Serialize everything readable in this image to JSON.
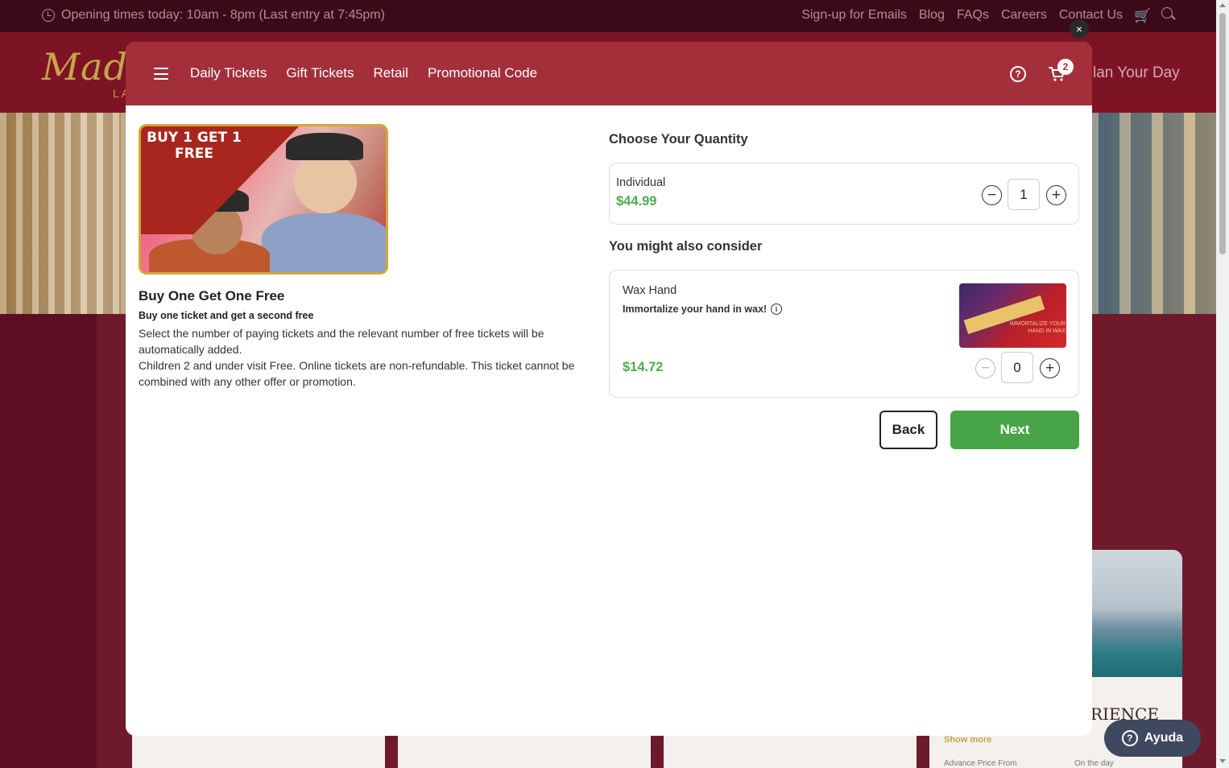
{
  "site": {
    "topbar": {
      "hours": "Opening times today: 10am - 8pm (Last entry at 7:45pm)",
      "links": [
        "Sign-up for Emails",
        "Blog",
        "FAQs",
        "Careers",
        "Contact Us"
      ]
    },
    "logo": "Madan",
    "logo_sub": "LA",
    "nav_partial": "lan Your Day",
    "card": {
      "title_partial": "RIENCE",
      "show_more": "Show more",
      "advance_price": "Advance Price From",
      "on_the_day": "On the day"
    },
    "help_pill": "Ayuda"
  },
  "modal": {
    "nav": [
      "Daily Tickets",
      "Gift Tickets",
      "Retail",
      "Promotional Code"
    ],
    "cart_count": "2",
    "close_label": "×",
    "offer": {
      "image_text": "BUY 1 GET 1 FREE",
      "title": "Buy One Get One Free",
      "subtitle": "Buy one ticket and get a second free",
      "description_1": "Select the number of paying tickets and the relevant number of free tickets will be automatically added.",
      "description_2": "Children 2 and under visit Free. Online tickets are non-refundable. This ticket cannot be combined with any other offer or promotion."
    },
    "quantity": {
      "heading": "Choose Your Quantity",
      "ticket_label": "Individual",
      "ticket_price": "$44.99",
      "ticket_qty": "1"
    },
    "upsell": {
      "heading": "You might also consider",
      "name": "Wax Hand",
      "description": "Immortalize your hand in wax!",
      "price": "$14.72",
      "qty": "0",
      "image_text": "IMMORTALIZE YOUR HAND IN WAX"
    },
    "buttons": {
      "back": "Back",
      "next": "Next"
    }
  },
  "colors": {
    "header_red": "#a32f3b",
    "price_green": "#4caf50",
    "next_green": "#47a447"
  }
}
